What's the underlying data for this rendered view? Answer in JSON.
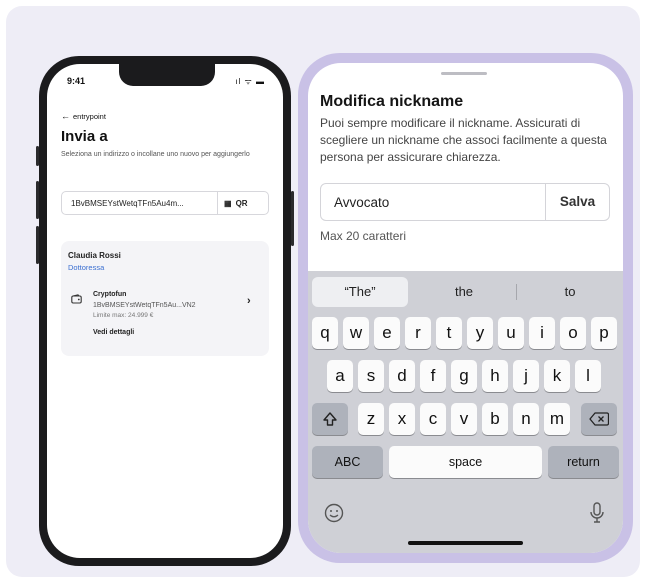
{
  "left_phone": {
    "status": {
      "time": "9:41",
      "icons": "ıl ᯤ ▬"
    },
    "back_label": "entrypoint",
    "title": "Invia a",
    "subtitle": "Seleziona un indirizzo o incollane uno nuovo per aggiungerlo",
    "address_input": {
      "value": "1BvBMSEYstWetqTFn5Au4m...",
      "qr_label": "QR"
    },
    "contact": {
      "name": "Claudia Rossi",
      "nickname": "Dottoressa",
      "wallet_name": "Cryptofun",
      "wallet_address": "1BvBMSEYstWetqTFn5Au...VN2",
      "limit": "Limite max: 24.999 €",
      "details_link": "Vedi dettagli"
    }
  },
  "right_phone": {
    "title": "Modifica nickname",
    "description": "Puoi sempre modificare il nickname. Assicurati di scegliere un nickname che associ facilmente a questa persona per assicurare chiarezza.",
    "nickname_input": {
      "value": "Avvocato"
    },
    "save_label": "Salva",
    "helper": "Max 20 caratteri",
    "keyboard": {
      "suggestions": [
        "“The”",
        "the",
        "to"
      ],
      "row1": [
        "q",
        "w",
        "e",
        "r",
        "t",
        "y",
        "u",
        "i",
        "o",
        "p"
      ],
      "row2": [
        "a",
        "s",
        "d",
        "f",
        "g",
        "h",
        "j",
        "k",
        "l"
      ],
      "row3": [
        "z",
        "x",
        "c",
        "v",
        "b",
        "n",
        "m"
      ],
      "abc_label": "ABC",
      "space_label": "space",
      "return_label": "return"
    }
  },
  "colors": {
    "accent_blue": "#3b6fd1",
    "phone_frame_purple": "#c9c1e6",
    "card_bg": "#eeedf6"
  }
}
